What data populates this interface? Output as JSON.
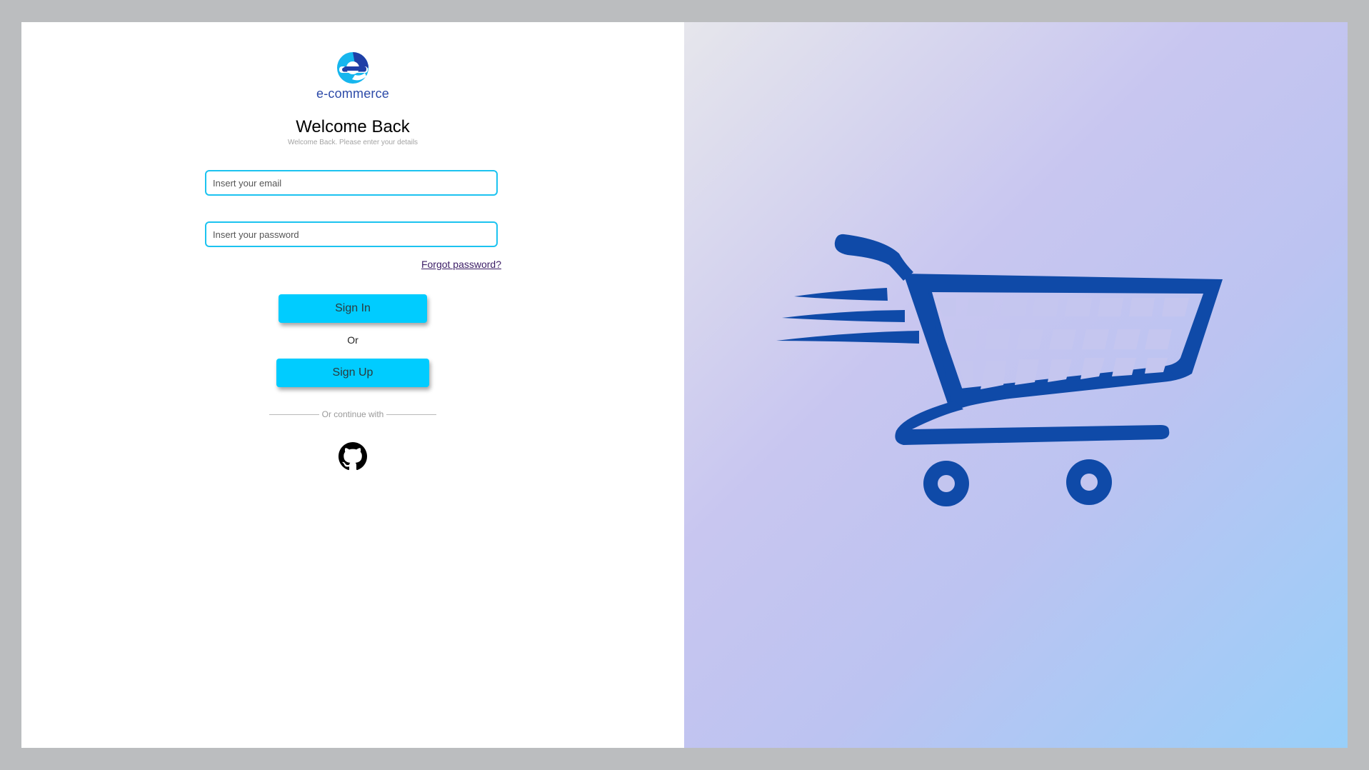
{
  "brand": {
    "name": "e-commerce",
    "logo_icon": "e-letter-logo-icon",
    "color": "#2c4aa8"
  },
  "header": {
    "title": "Welcome Back",
    "subtitle": "Welcome Back. Please enter your details"
  },
  "form": {
    "email_placeholder": "Insert your email",
    "email_value": "",
    "password_placeholder": "Insert your password",
    "password_value": "",
    "forgot_label": "Forgot password?",
    "signin_label": "Sign In",
    "or_label": "Or",
    "signup_label": "Sign Up"
  },
  "social": {
    "divider_label": "Or continue with",
    "providers": [
      {
        "icon": "github-icon"
      }
    ]
  },
  "hero": {
    "icon": "shopping-cart-icon",
    "color": "#0f4aa8"
  },
  "colors": {
    "accent": "#00ccff",
    "field_border": "#1cc3f0",
    "link": "#3b1d66"
  }
}
